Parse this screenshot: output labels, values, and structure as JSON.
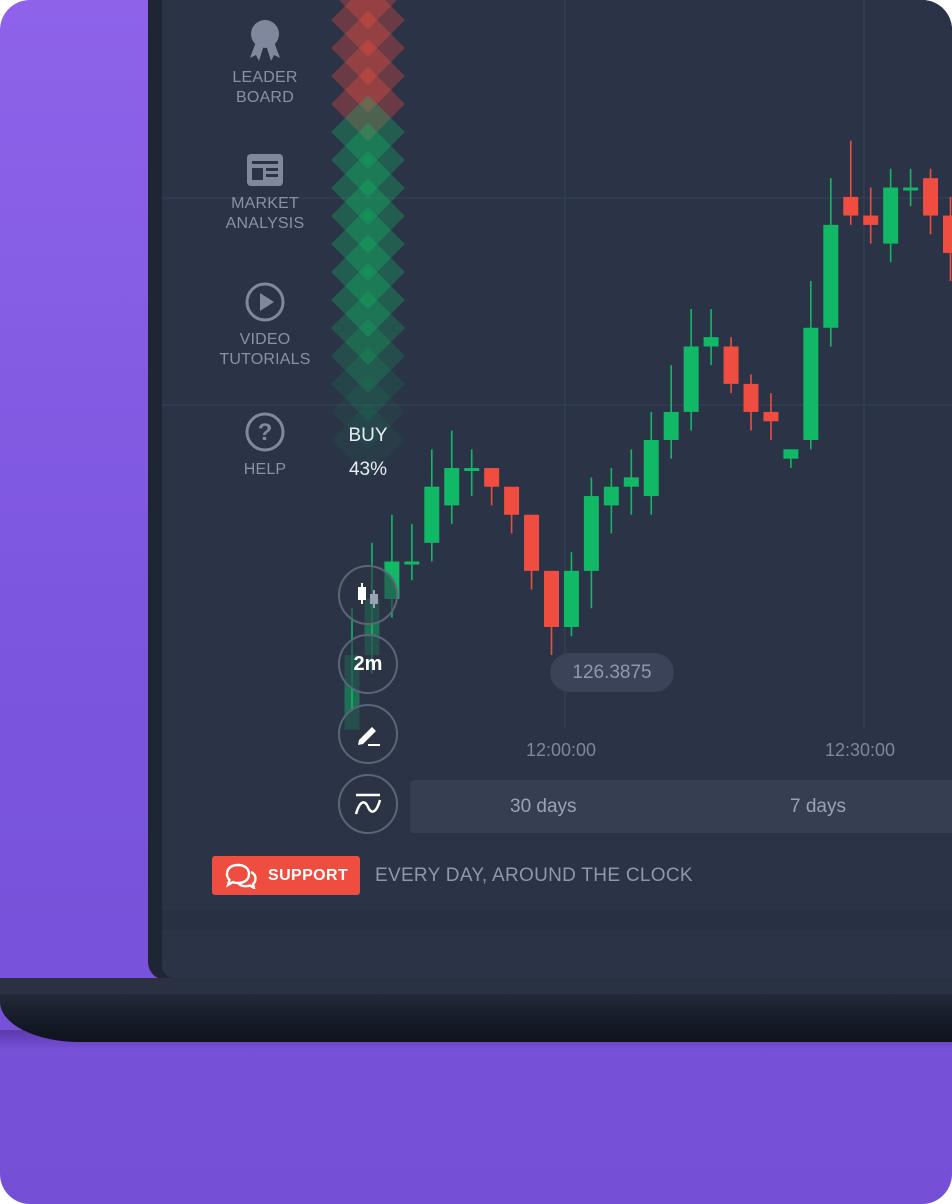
{
  "sidebar": {
    "items": [
      {
        "label": "LEADER\nBOARD",
        "icon": "award-ribbon-icon"
      },
      {
        "label": "MARKET\nANALYSIS",
        "icon": "newspaper-icon"
      },
      {
        "label": "VIDEO\nTUTORIALS",
        "icon": "play-circle-icon"
      },
      {
        "label": "HELP",
        "icon": "question-circle-icon"
      }
    ]
  },
  "sentiment": {
    "label": "BUY",
    "value": "43%",
    "buy_share": 0.43
  },
  "toolbar": {
    "chart_type_icon": "candlestick-icon",
    "timeframe": "2m",
    "draw_icon": "pencil-icon",
    "indicator_icon": "indicator-wave-icon"
  },
  "price_tag": "126.3875",
  "time_axis": [
    "12:00:00",
    "12:30:00"
  ],
  "ranges": [
    "30 days",
    "7 days"
  ],
  "support": {
    "button_label": "SUPPORT",
    "text": "EVERY DAY, AROUND THE CLOCK",
    "icon": "chat-bubbles-icon"
  },
  "colors": {
    "background": "#2b3346",
    "up": "#11b866",
    "down": "#ee4d40",
    "support": "#ee4d40",
    "purple": "#8262e2"
  },
  "chart_data": {
    "type": "candlestick",
    "x": [
      "",
      "",
      "",
      "",
      "",
      "",
      "",
      "",
      "",
      "",
      "",
      "",
      "",
      "",
      "",
      "",
      "",
      "",
      "",
      "",
      "",
      "",
      "",
      "",
      "",
      "",
      "",
      "",
      "",
      "",
      ""
    ],
    "series": [
      {
        "open": [
          126.3,
          126.38,
          126.44,
          126.48,
          126.5,
          126.54,
          126.58,
          126.58,
          126.56,
          126.53,
          126.47,
          126.41,
          126.47,
          126.54,
          126.56,
          126.55,
          126.61,
          126.64,
          126.71,
          126.71,
          126.67,
          126.64,
          126.59,
          126.61,
          126.73,
          126.87,
          126.85,
          126.82,
          126.88,
          126.89,
          126.85
        ],
        "close": [
          126.38,
          126.44,
          126.48,
          126.48,
          126.56,
          126.58,
          126.58,
          126.56,
          126.53,
          126.47,
          126.41,
          126.47,
          126.55,
          126.56,
          126.57,
          126.61,
          126.64,
          126.71,
          126.72,
          126.67,
          126.64,
          126.63,
          126.6,
          126.73,
          126.84,
          126.85,
          126.84,
          126.88,
          126.88,
          126.85,
          126.81
        ]
      }
    ],
    "high": [
      126.43,
      126.5,
      126.53,
      126.52,
      126.6,
      126.62,
      126.6,
      126.58,
      126.55,
      126.53,
      126.47,
      126.49,
      126.57,
      126.58,
      126.6,
      126.64,
      126.69,
      126.75,
      126.75,
      126.72,
      126.68,
      126.66,
      126.6,
      126.78,
      126.89,
      126.93,
      126.88,
      126.9,
      126.9,
      126.9,
      126.87
    ],
    "low": [
      126.32,
      126.36,
      126.42,
      126.46,
      126.48,
      126.52,
      126.55,
      126.54,
      126.51,
      126.45,
      126.38,
      126.4,
      126.43,
      126.51,
      126.53,
      126.53,
      126.59,
      126.62,
      126.69,
      126.66,
      126.62,
      126.61,
      126.58,
      126.6,
      126.71,
      126.84,
      126.82,
      126.8,
      126.86,
      126.83,
      126.78
    ]
  }
}
